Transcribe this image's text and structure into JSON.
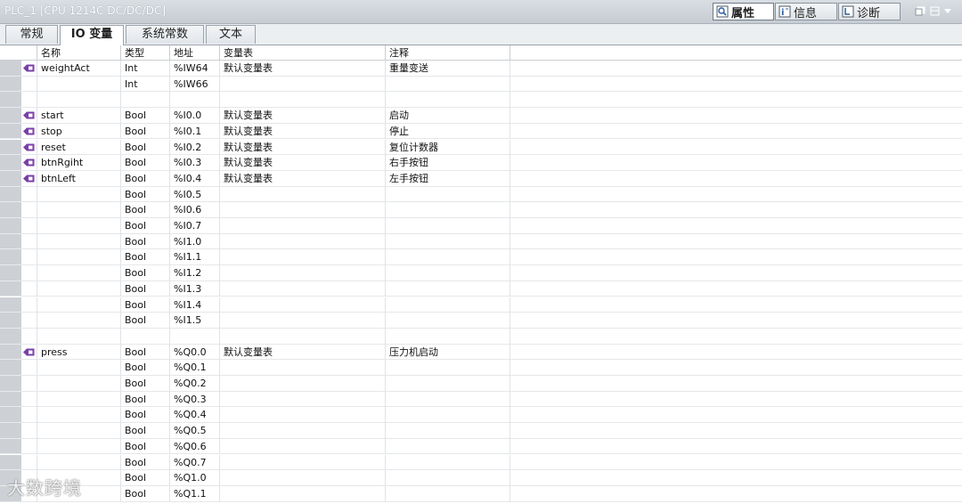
{
  "window": {
    "title": "PLC_1 [CPU 1214C DC/DC/DC]",
    "inspector_tabs": [
      {
        "label": "属性",
        "icon": "properties-icon",
        "active": true
      },
      {
        "label": "信息",
        "icon": "info-icon",
        "active": false
      },
      {
        "label": "诊断",
        "icon": "diagnostics-icon",
        "active": false
      }
    ]
  },
  "tabs": [
    {
      "label": "常规",
      "active": false
    },
    {
      "label": "IO 变量",
      "active": true
    },
    {
      "label": "系统常数",
      "active": false
    },
    {
      "label": "文本",
      "active": false
    }
  ],
  "table": {
    "headers": {
      "name": "名称",
      "type": "类型",
      "address": "地址",
      "tag_table": "变量表",
      "comment": "注释"
    },
    "rows": [
      {
        "name": "weightAct",
        "type": "Int",
        "address": "%IW64",
        "tag_table": "默认变量表",
        "comment": "重量变送",
        "has_icon": true
      },
      {
        "name": "",
        "type": "Int",
        "address": "%IW66",
        "tag_table": "",
        "comment": "",
        "has_icon": false
      },
      {
        "name": "",
        "type": "",
        "address": "",
        "tag_table": "",
        "comment": "",
        "has_icon": false
      },
      {
        "name": "start",
        "type": "Bool",
        "address": "%I0.0",
        "tag_table": "默认变量表",
        "comment": "启动",
        "has_icon": true
      },
      {
        "name": "stop",
        "type": "Bool",
        "address": "%I0.1",
        "tag_table": "默认变量表",
        "comment": "停止",
        "has_icon": true
      },
      {
        "name": "reset",
        "type": "Bool",
        "address": "%I0.2",
        "tag_table": "默认变量表",
        "comment": "复位计数器",
        "has_icon": true
      },
      {
        "name": "btnRgiht",
        "type": "Bool",
        "address": "%I0.3",
        "tag_table": "默认变量表",
        "comment": "右手按钮",
        "has_icon": true
      },
      {
        "name": "btnLeft",
        "type": "Bool",
        "address": "%I0.4",
        "tag_table": "默认变量表",
        "comment": "左手按钮",
        "has_icon": true
      },
      {
        "name": "",
        "type": "Bool",
        "address": "%I0.5",
        "tag_table": "",
        "comment": "",
        "has_icon": false
      },
      {
        "name": "",
        "type": "Bool",
        "address": "%I0.6",
        "tag_table": "",
        "comment": "",
        "has_icon": false
      },
      {
        "name": "",
        "type": "Bool",
        "address": "%I0.7",
        "tag_table": "",
        "comment": "",
        "has_icon": false
      },
      {
        "name": "",
        "type": "Bool",
        "address": "%I1.0",
        "tag_table": "",
        "comment": "",
        "has_icon": false
      },
      {
        "name": "",
        "type": "Bool",
        "address": "%I1.1",
        "tag_table": "",
        "comment": "",
        "has_icon": false
      },
      {
        "name": "",
        "type": "Bool",
        "address": "%I1.2",
        "tag_table": "",
        "comment": "",
        "has_icon": false
      },
      {
        "name": "",
        "type": "Bool",
        "address": "%I1.3",
        "tag_table": "",
        "comment": "",
        "has_icon": false
      },
      {
        "name": "",
        "type": "Bool",
        "address": "%I1.4",
        "tag_table": "",
        "comment": "",
        "has_icon": false
      },
      {
        "name": "",
        "type": "Bool",
        "address": "%I1.5",
        "tag_table": "",
        "comment": "",
        "has_icon": false
      },
      {
        "name": "",
        "type": "",
        "address": "",
        "tag_table": "",
        "comment": "",
        "has_icon": false
      },
      {
        "name": "press",
        "type": "Bool",
        "address": "%Q0.0",
        "tag_table": "默认变量表",
        "comment": "压力机启动",
        "has_icon": true
      },
      {
        "name": "",
        "type": "Bool",
        "address": "%Q0.1",
        "tag_table": "",
        "comment": "",
        "has_icon": false
      },
      {
        "name": "",
        "type": "Bool",
        "address": "%Q0.2",
        "tag_table": "",
        "comment": "",
        "has_icon": false
      },
      {
        "name": "",
        "type": "Bool",
        "address": "%Q0.3",
        "tag_table": "",
        "comment": "",
        "has_icon": false
      },
      {
        "name": "",
        "type": "Bool",
        "address": "%Q0.4",
        "tag_table": "",
        "comment": "",
        "has_icon": false
      },
      {
        "name": "",
        "type": "Bool",
        "address": "%Q0.5",
        "tag_table": "",
        "comment": "",
        "has_icon": false
      },
      {
        "name": "",
        "type": "Bool",
        "address": "%Q0.6",
        "tag_table": "",
        "comment": "",
        "has_icon": false
      },
      {
        "name": "",
        "type": "Bool",
        "address": "%Q0.7",
        "tag_table": "",
        "comment": "",
        "has_icon": false
      },
      {
        "name": "",
        "type": "Bool",
        "address": "%Q1.0",
        "tag_table": "",
        "comment": "",
        "has_icon": false
      },
      {
        "name": "",
        "type": "Bool",
        "address": "%Q1.1",
        "tag_table": "",
        "comment": "",
        "has_icon": false
      }
    ]
  },
  "watermark": "大数跨境",
  "colors": {
    "selector_column": "#cdd1d5",
    "tag_icon": "#7a3fa8",
    "titlebar": "#c6ccd2"
  }
}
